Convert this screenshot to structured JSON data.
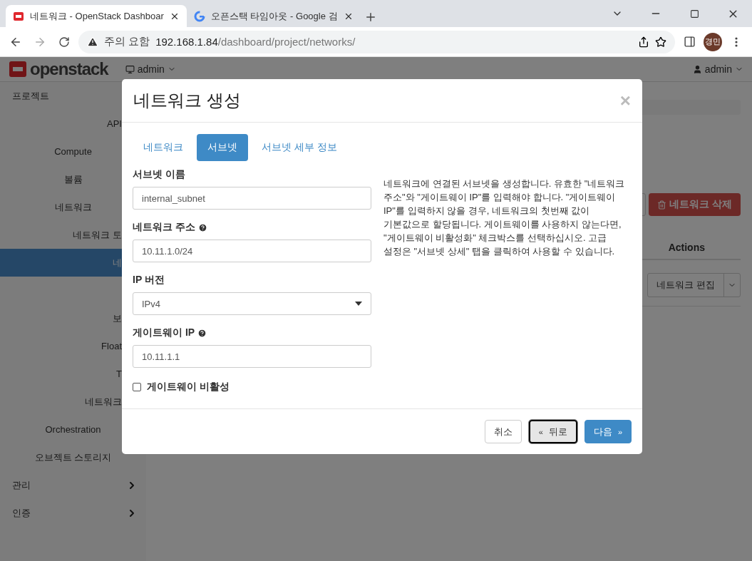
{
  "browser": {
    "tabs": [
      {
        "title": "네트워크 - OpenStack Dashboar",
        "selected": true,
        "kind": "openstack"
      },
      {
        "title": "오픈스택 타임아웃 - Google 검",
        "selected": false,
        "kind": "google"
      }
    ],
    "security_label": "주의 요함",
    "url_host": "192.168.1.84",
    "url_path": "/dashboard/project/networks/",
    "profile": "경민"
  },
  "header": {
    "logo": "openstack",
    "project": "admin",
    "user": "admin"
  },
  "sidebar": {
    "items": [
      {
        "label": "프로젝트",
        "kind": "section",
        "selected": false
      },
      {
        "label": "API",
        "kind": "cut",
        "selected": false
      },
      {
        "label": "Compute",
        "kind": "item",
        "selected": false
      },
      {
        "label": "볼륨",
        "kind": "item",
        "selected": false
      },
      {
        "label": "네트워크",
        "kind": "item",
        "selected": false
      },
      {
        "label": "네트워크 토",
        "kind": "cut",
        "selected": false
      },
      {
        "label": "네",
        "kind": "cut",
        "selected": true
      },
      {
        "kind": "hidden",
        "selected": false
      },
      {
        "label": "보",
        "kind": "cut",
        "selected": false
      },
      {
        "label": "Float",
        "kind": "cut",
        "selected": false
      },
      {
        "label": "T",
        "kind": "cut",
        "selected": false
      },
      {
        "label": "네트워크",
        "kind": "cut",
        "selected": false
      },
      {
        "label": "Orchestration",
        "kind": "item",
        "selected": false
      },
      {
        "label": "오브젝트 스토리지",
        "kind": "item",
        "selected": false
      },
      {
        "label": "관리",
        "kind": "section",
        "selected": false,
        "chevron": true
      },
      {
        "label": "인증",
        "kind": "section",
        "selected": false,
        "chevron": true
      }
    ]
  },
  "main": {
    "delete_button": "네트워크 삭제",
    "table_header": "Actions",
    "row_action": "네트워크 편집"
  },
  "modal": {
    "title": "네트워크 생성",
    "close": "×",
    "tabs": [
      {
        "label": "네트워크",
        "selected": false
      },
      {
        "label": "서브넷",
        "selected": true
      },
      {
        "label": "서브넷 세부 정보",
        "selected": false
      }
    ],
    "fields": [
      {
        "label": "서브넷 이름",
        "kind": "text",
        "help": false,
        "value": "internal_subnet"
      },
      {
        "label": "네트워크 주소",
        "kind": "text",
        "help": true,
        "value": "10.11.1.0/24"
      },
      {
        "label": "IP 버전",
        "kind": "select",
        "help": false,
        "value": "IPv4"
      },
      {
        "label": "게이트웨이 IP",
        "kind": "text",
        "help": true,
        "value": "10.11.1.1"
      }
    ],
    "checkbox": {
      "label": "게이트웨이 비활성",
      "checked": false
    },
    "description": "네트워크에 연결된 서브넷을 생성합니다. 유효한 \"네트워크 주소\"와 \"게이트웨이 IP\"를 입력해야 합니다. \"게이트웨이 IP\"를 입력하지 않을 경우, 네트워크의 첫번째 값이 기본값으로 할당됩니다. 게이트웨이를 사용하지 않는다면, \"게이트웨이 비활성화\" 체크박스를 선택하십시오. 고급 설정은 \"서브넷 상세\" 탭을 클릭하여 사용할 수 있습니다.",
    "buttons": [
      {
        "label": "취소",
        "kind": "default",
        "focused": false
      },
      {
        "label": "뒤로",
        "prefix": "«",
        "kind": "default",
        "focused": true
      },
      {
        "label": "다음",
        "suffix": "»",
        "kind": "primary",
        "focused": false
      }
    ]
  }
}
